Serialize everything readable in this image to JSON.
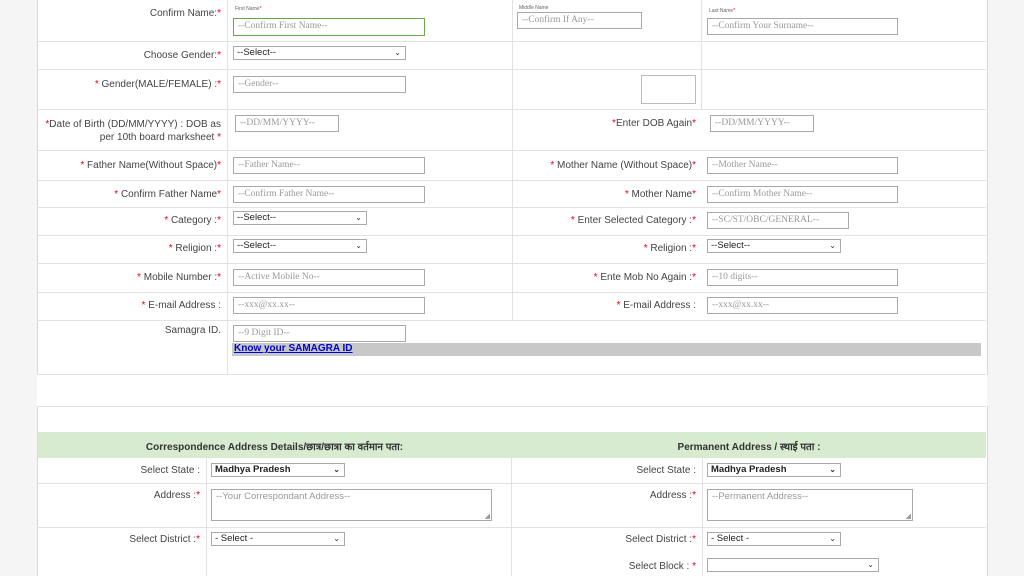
{
  "personal": {
    "confirm_name": {
      "label": "Confirm Name:",
      "first_name": {
        "label": "First Name",
        "placeholder": "--Confirm First Name--"
      },
      "middle_name": {
        "label": "Middle Name",
        "placeholder": "--Confirm If Any--"
      },
      "last_name": {
        "label": "Last Name",
        "placeholder": "--Confirm Your Surname--"
      }
    },
    "choose_gender": {
      "label": "Choose Gender:",
      "value": "--Select--"
    },
    "gender_text": {
      "label": "Gender(MALE/FEMALE) :",
      "placeholder": "--Gender--"
    },
    "dob": {
      "label_line1": "Date of Birth (DD/MM/YYYY) : DOB as",
      "label_line2": "per 10th board marksheet",
      "placeholder": "--DD/MM/YYYY--"
    },
    "dob_again": {
      "label": "Enter DOB Again",
      "placeholder": "--DD/MM/YYYY--"
    },
    "father_name": {
      "label": "Father Name(Without Space)",
      "placeholder": "--Father Name--"
    },
    "mother_name": {
      "label": "Mother Name (Without Space)",
      "placeholder": "--Mother Name--"
    },
    "confirm_father": {
      "label": "Confirm Father Name",
      "placeholder": "--Confirm Father Name--"
    },
    "confirm_mother": {
      "label": "Mother Name",
      "placeholder": "--Confirm Mother Name--"
    },
    "category": {
      "label": "Category :",
      "value": "--Select--"
    },
    "selected_category": {
      "label": "Enter Selected Category :",
      "placeholder": "--SC/ST/OBC/GENERAL--"
    },
    "religion": {
      "label": "Religion :",
      "value": "--Select--"
    },
    "religion2": {
      "label": "Religion :",
      "value": "--Select--"
    },
    "mobile": {
      "label": "Mobile Number :",
      "placeholder": "--Active Mobile No--"
    },
    "mobile_again": {
      "label": "Ente Mob No Again :",
      "placeholder": "--10 digits--"
    },
    "email": {
      "label": "E-mail Address :",
      "placeholder": "--xxx@xx.xx--"
    },
    "email2": {
      "label": "E-mail Address :",
      "placeholder": "--xxx@xx.xx--"
    },
    "samagra": {
      "label": "Samagra ID.",
      "placeholder": "--9 Digit ID--",
      "link": "Know your SAMAGRA ID"
    }
  },
  "address": {
    "correspondence": {
      "header": "Correspondence Address Details/छात्र/छात्रा का वर्तमान पता:",
      "state": {
        "label": "Select State :",
        "value": "Madhya Pradesh"
      },
      "address": {
        "label": "Address :",
        "placeholder": "--Your Correspondant Address--"
      },
      "district": {
        "label": "Select District :",
        "value": "- Select -"
      }
    },
    "permanent": {
      "header": "Permanent Address / स्थाई पता :",
      "state": {
        "label": "Select State :",
        "value": "Madhya Pradesh"
      },
      "address": {
        "label": "Address :",
        "placeholder": "--Permanent Address--"
      },
      "district": {
        "label": "Select District :",
        "value": "- Select -"
      },
      "block": {
        "label": "Select Block :",
        "value": ""
      }
    }
  },
  "req_mark": "*",
  "chevron": "⌄",
  "grip": "◢"
}
